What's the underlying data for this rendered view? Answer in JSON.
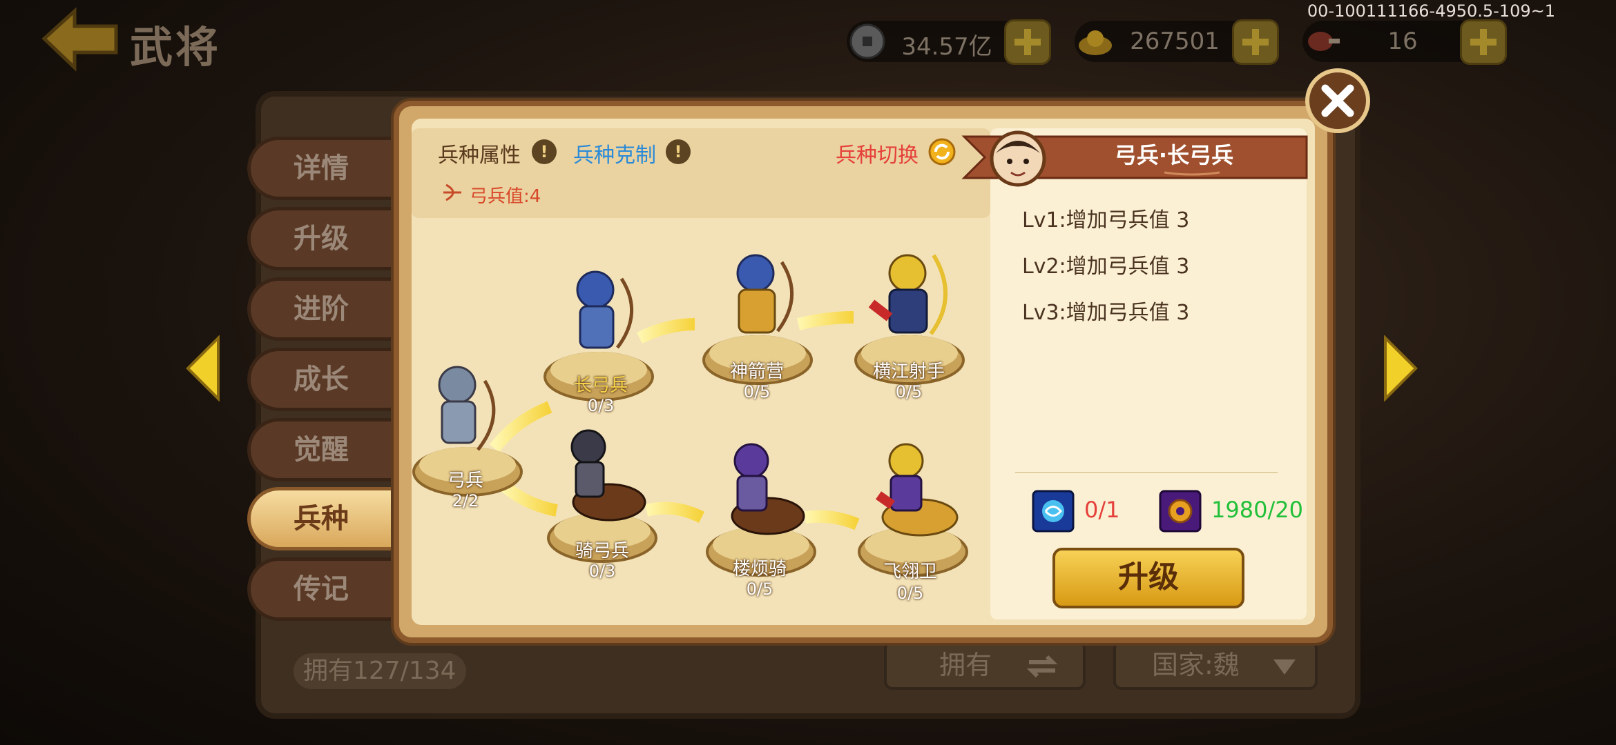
{
  "header": {
    "title": "武将",
    "build_id": "00-100111166-4950.5-109~1",
    "resources": [
      {
        "icon": "coin-icon",
        "value": "34.57亿"
      },
      {
        "icon": "gold-ingot-icon",
        "value": "267501"
      },
      {
        "icon": "meat-icon",
        "value": "16"
      }
    ]
  },
  "tabs": [
    {
      "label": "详情"
    },
    {
      "label": "升级"
    },
    {
      "label": "进阶"
    },
    {
      "label": "成长"
    },
    {
      "label": "觉醒"
    },
    {
      "label": "兵种"
    },
    {
      "label": "传记"
    }
  ],
  "footer": {
    "owned": "拥有127/134",
    "sort_label": "拥有",
    "country_label": "国家:魏"
  },
  "troop": {
    "attr_label": "兵种属性",
    "counter_label": "兵种克制",
    "switch_label": "兵种切换",
    "archer_value": "弓兵值:4",
    "nodes": [
      {
        "name": "弓兵",
        "progress": "2/2"
      },
      {
        "name": "长弓兵",
        "progress": "0/3"
      },
      {
        "name": "神箭营",
        "progress": "0/5"
      },
      {
        "name": "横江射手",
        "progress": "0/5"
      },
      {
        "name": "骑弓兵",
        "progress": "0/3"
      },
      {
        "name": "楼烦骑",
        "progress": "0/5"
      },
      {
        "name": "飞翎卫",
        "progress": "0/5"
      }
    ]
  },
  "detail": {
    "title": "弓兵·长弓兵",
    "levels": [
      "Lv1:增加弓兵值 3",
      "Lv2:增加弓兵值 3",
      "Lv3:增加弓兵值 3"
    ],
    "costs": [
      {
        "icon": "blue-rune-icon",
        "value": "0/1",
        "color": "#e5403a"
      },
      {
        "icon": "purple-gear-icon",
        "value": "1980/20",
        "color": "#22c03a"
      }
    ],
    "upgrade_label": "升级"
  },
  "colors": {
    "accent_gold": "#f7d156",
    "tab_active": "#e8c07a",
    "switch_red": "#e5403a",
    "counter_blue": "#2a8ad8"
  }
}
